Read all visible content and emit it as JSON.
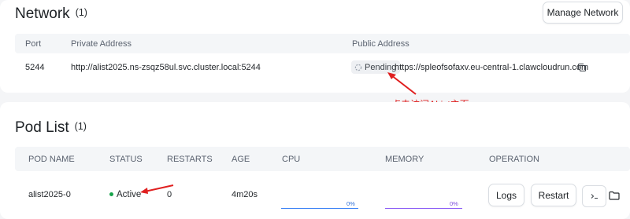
{
  "network": {
    "title": "Network",
    "count": "(1)",
    "manage_button": "Manage Network",
    "headers": {
      "port": "Port",
      "private": "Private Address",
      "public": "Public Address"
    },
    "row": {
      "port": "5244",
      "private": "http://alist2025.ns-zsqz58ul.svc.cluster.local:5244",
      "status": "Pending",
      "public": "https://spleofsofaxv.eu-central-1.clawcloudrun.com"
    },
    "annotation": "点击访问AList主页"
  },
  "pods": {
    "title": "Pod List",
    "count": "(1)",
    "headers": {
      "name": "POD NAME",
      "status": "STATUS",
      "restarts": "RESTARTS",
      "age": "AGE",
      "cpu": "CPU",
      "memory": "MEMORY",
      "operation": "OPERATION"
    },
    "row": {
      "name": "alist2025-0",
      "status": "Active",
      "restarts": "0",
      "age": "4m20s",
      "cpu_percent": "0%",
      "memory_percent": "0%"
    },
    "buttons": {
      "logs": "Logs",
      "restart": "Restart"
    }
  },
  "colors": {
    "annotation": "#e02020",
    "active_dot": "#16a34a",
    "cpu_line": "#3b82f6",
    "memory_line": "#8b5cf6"
  },
  "icons": [
    "copy-icon",
    "loading-icon",
    "terminal-icon",
    "folder-icon",
    "annotation-arrow-icon"
  ]
}
